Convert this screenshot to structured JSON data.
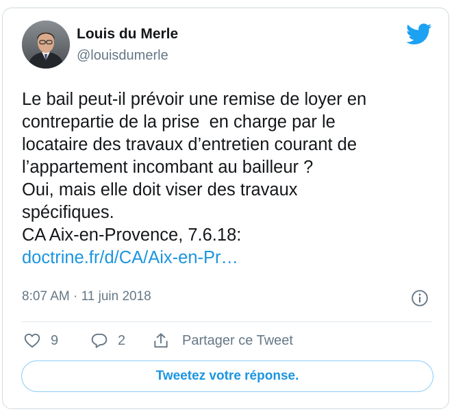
{
  "author": {
    "name": "Louis du Merle",
    "handle": "@louisdumerle"
  },
  "tweet": {
    "lines": [
      "Le bail peut-il prévoir une remise de loyer en",
      "contrepartie de la prise  en charge par le",
      "locataire des travaux d’entretien courant de",
      "l’appartement incombant au bailleur ?",
      "Oui, mais elle doit viser des travaux",
      "spécifiques.",
      "CA Aix-en-Provence, 7.6.18:"
    ],
    "link_text": "doctrine.fr/d/CA/Aix-en-Pr…",
    "timestamp": "8:07 AM · 11 juin 2018"
  },
  "actions": {
    "like_count": "9",
    "reply_count": "2",
    "share_label": "Partager ce Tweet"
  },
  "reply_button_label": "Tweetez votre réponse.",
  "icons": {
    "logo": "twitter-bird-icon",
    "info": "info-icon",
    "like": "heart-icon",
    "reply": "speech-bubble-icon",
    "share": "share-icon"
  },
  "colors": {
    "brand_blue": "#1da1f2",
    "link_blue": "#1b95e0",
    "muted_gray": "#657786",
    "text": "#14171a",
    "border": "#cfd9de"
  }
}
